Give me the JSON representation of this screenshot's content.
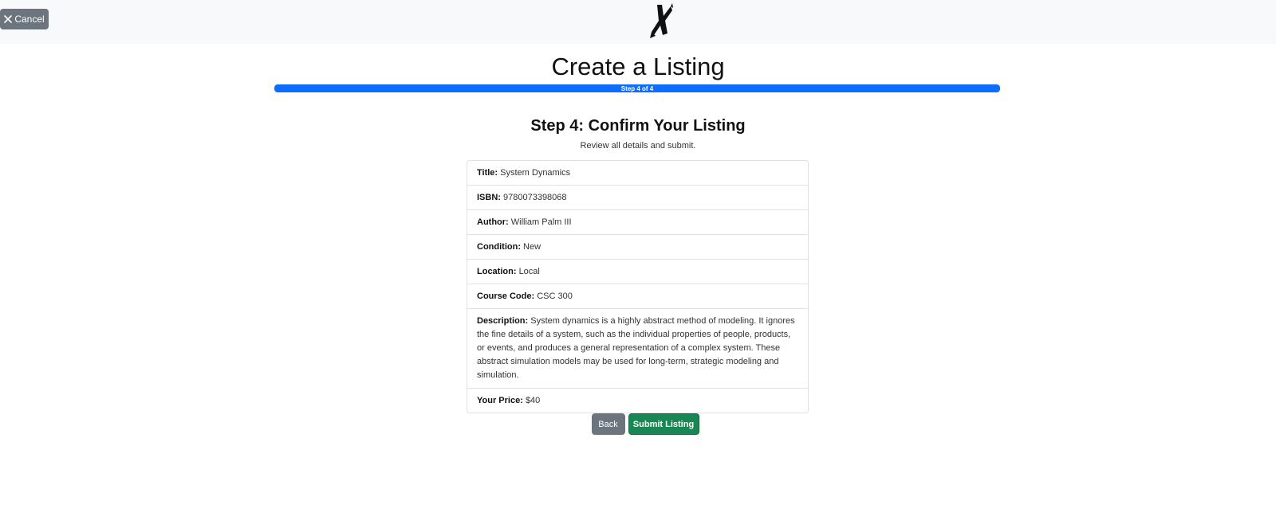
{
  "header": {
    "cancel_label": "Cancel"
  },
  "page": {
    "title": "Create a Listing",
    "progress": {
      "label": "Step 4 of 4",
      "percent": 100
    }
  },
  "step": {
    "title": "Step 4: Confirm Your Listing",
    "subtitle": "Review all details and submit."
  },
  "details": [
    {
      "label": "Title:",
      "value": "System Dynamics"
    },
    {
      "label": "ISBN:",
      "value": "9780073398068"
    },
    {
      "label": "Author:",
      "value": "William Palm III"
    },
    {
      "label": "Condition:",
      "value": "New"
    },
    {
      "label": "Location:",
      "value": "Local"
    },
    {
      "label": "Course Code:",
      "value": "CSC 300"
    },
    {
      "label": "Description:",
      "value": "System dynamics is a highly abstract method of modeling. It ignores the fine details of a system, such as the individual properties of people, products, or events, and produces a general representation of a complex system. These abstract simulation models may be used for long-term, strategic modeling and simulation."
    },
    {
      "label": "Your Price:",
      "value": "$40"
    }
  ],
  "actions": {
    "back_label": "Back",
    "submit_label": "Submit Listing"
  },
  "colors": {
    "progress": "#0d6efd",
    "submit": "#198754",
    "secondary": "#6c757d"
  },
  "icons": {
    "cancel": "close-icon",
    "logo": "logo-icon"
  }
}
